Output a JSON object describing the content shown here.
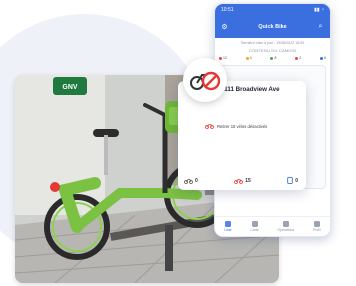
{
  "phone": {
    "status_time": "10:51",
    "header_title": "Quick Bike",
    "subheader": "Dernière mise à jour : 19/08/2022 18:09",
    "section_title": "CONTENU DU CAMION",
    "chips": [
      {
        "label": "12",
        "color": "#e24c4c"
      },
      {
        "label": "4",
        "color": "#f3a23b"
      },
      {
        "label": "8",
        "color": "#4caf50"
      },
      {
        "label": "2",
        "color": "#e24c4c"
      },
      {
        "label": "6",
        "color": "#3b6fe0"
      }
    ],
    "nav": [
      {
        "label": "Liste",
        "active": true
      },
      {
        "label": "Carte",
        "active": false
      },
      {
        "label": "Opérations",
        "active": false
      },
      {
        "label": "Profil",
        "active": false
      }
    ]
  },
  "card": {
    "address": "7702 - 111 Broadview Ave",
    "action_label": "Retirer 15 vélos désactivés",
    "stats": {
      "bikes": "0",
      "disabled": "15",
      "parking": "0"
    }
  },
  "photo": {
    "station_sign": "GNV"
  },
  "colors": {
    "accent": "#3b6fe0",
    "alert": "#e53935",
    "bike_green": "#7cc242"
  },
  "icons": {
    "badge": "bike-disabled-icon"
  }
}
